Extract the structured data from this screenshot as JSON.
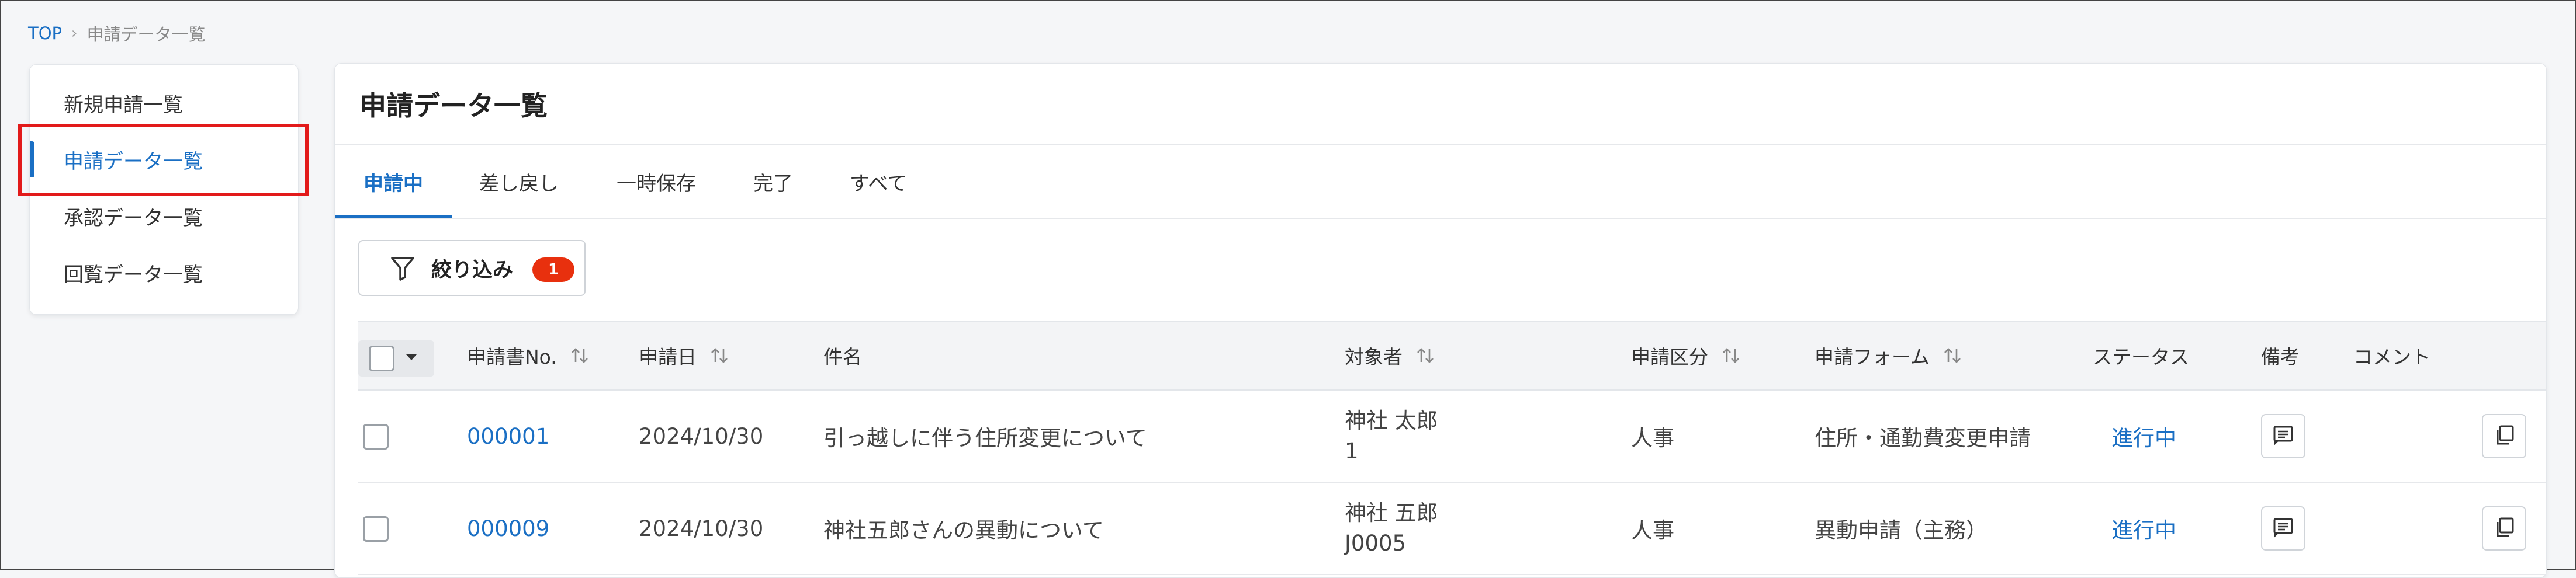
{
  "breadcrumb": {
    "top": "TOP",
    "separator": "›",
    "current": "申請データ一覧"
  },
  "sidebar": {
    "items": [
      {
        "label": "新規申請一覧",
        "active": false
      },
      {
        "label": "申請データ一覧",
        "active": true
      },
      {
        "label": "承認データ一覧",
        "active": false
      },
      {
        "label": "回覧データ一覧",
        "active": false
      }
    ]
  },
  "main": {
    "title": "申請データ一覧",
    "tabs": [
      {
        "label": "申請中",
        "active": true
      },
      {
        "label": "差し戻し",
        "active": false
      },
      {
        "label": "一時保存",
        "active": false
      },
      {
        "label": "完了",
        "active": false
      },
      {
        "label": "すべて",
        "active": false
      }
    ],
    "filter": {
      "label": "絞り込み",
      "count": "1",
      "icon": "filter-icon"
    }
  },
  "table": {
    "headers": {
      "no": "申請書No.",
      "date": "申請日",
      "subject": "件名",
      "target": "対象者",
      "category": "申請区分",
      "form": "申請フォーム",
      "status": "ステータス",
      "remarks": "備考",
      "comment": "コメント"
    },
    "rows": [
      {
        "no": "000001",
        "date": "2024/10/30",
        "subject": "引っ越しに伴う住所変更について",
        "target_name": "神社 太郎",
        "target_id": "1",
        "category": "人事",
        "form": "住所・通勤費変更申請",
        "status": "進行中"
      },
      {
        "no": "000009",
        "date": "2024/10/30",
        "subject": "神社五郎さんの異動について",
        "target_name": "神社 五郎",
        "target_id": "J0005",
        "category": "人事",
        "form": "異動申請（主務）",
        "status": "進行中"
      }
    ]
  },
  "colors": {
    "accent": "#1a6fc4",
    "badge": "#e8300e",
    "highlight": "#e21a1a"
  }
}
